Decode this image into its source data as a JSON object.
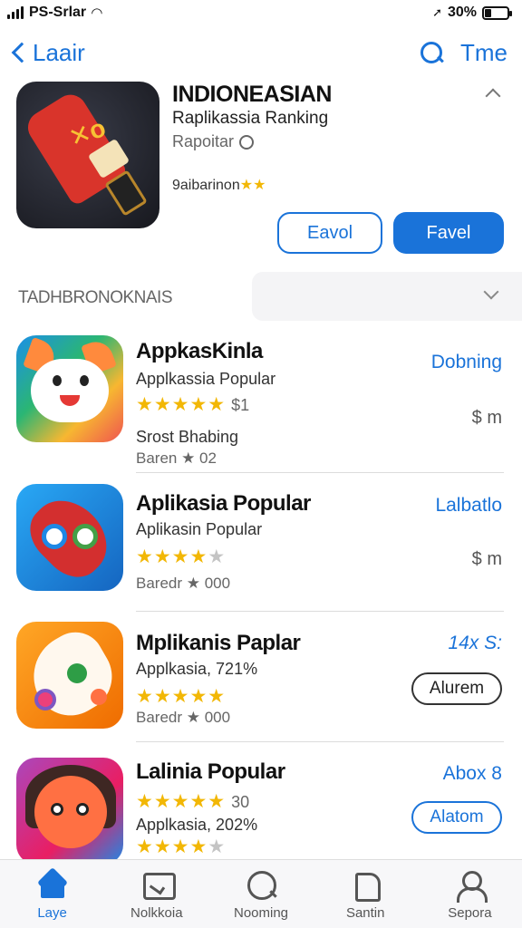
{
  "status_bar": {
    "carrier": "PS-Srlar",
    "battery": "30%",
    "battery_level": 0.3
  },
  "nav": {
    "back_label": "Laair",
    "right_label": "Tme"
  },
  "featured": {
    "title": "INDIONEASIAN",
    "subtitle": "Raplikassia Ranking",
    "subtitle2": "Rapoitar",
    "rating_text": "9aibarinon",
    "rating_stars": "★★",
    "button_outline": "Eavol",
    "button_fill": "Favel"
  },
  "section": {
    "label": "TADHBRONOKNAIS"
  },
  "apps": [
    {
      "title": "AppkasKinla",
      "line1": "Applkassia Popular",
      "stars": "★★★★★",
      "stars_empty": "",
      "stars_extra": "$1",
      "line2": "Srost Bhabing",
      "line3": "Baren ★ 02",
      "right_link": "Dobning",
      "right_price": "$ m"
    },
    {
      "title": "Aplikasia Popular",
      "line1": "Aplikasin Popular",
      "stars": "★★★★",
      "stars_empty": "★",
      "stars_extra": "",
      "line3": "Baredr ★ 000",
      "right_link": "Lalbatlo",
      "right_price": "$ m"
    },
    {
      "title": "Mplikanis Paplar",
      "line1": "Applkasia, 721%",
      "stars": "★★★★★",
      "stars_empty": "",
      "stars_extra": "",
      "line3": "Baredr ★ 000",
      "right_link": "14x S:",
      "button": "Alurem"
    },
    {
      "title": "Lalinia Popular",
      "stars": "★★★★★",
      "stars_empty": "",
      "stars_extra": "30",
      "line1": "Applkasia, 202%",
      "stars2": "★★★★",
      "stars2_empty": "★",
      "right_link": "Abox 8",
      "button": "Alatom"
    }
  ],
  "tabs": [
    {
      "label": "Laye",
      "icon": "home-icon"
    },
    {
      "label": "Nolkkoia",
      "icon": "games-icon"
    },
    {
      "label": "Nooming",
      "icon": "search-icon"
    },
    {
      "label": "Santin",
      "icon": "arcade-icon"
    },
    {
      "label": "Sepora",
      "icon": "person-icon"
    }
  ],
  "colors": {
    "accent": "#1a73d9",
    "star": "#f2b705"
  }
}
